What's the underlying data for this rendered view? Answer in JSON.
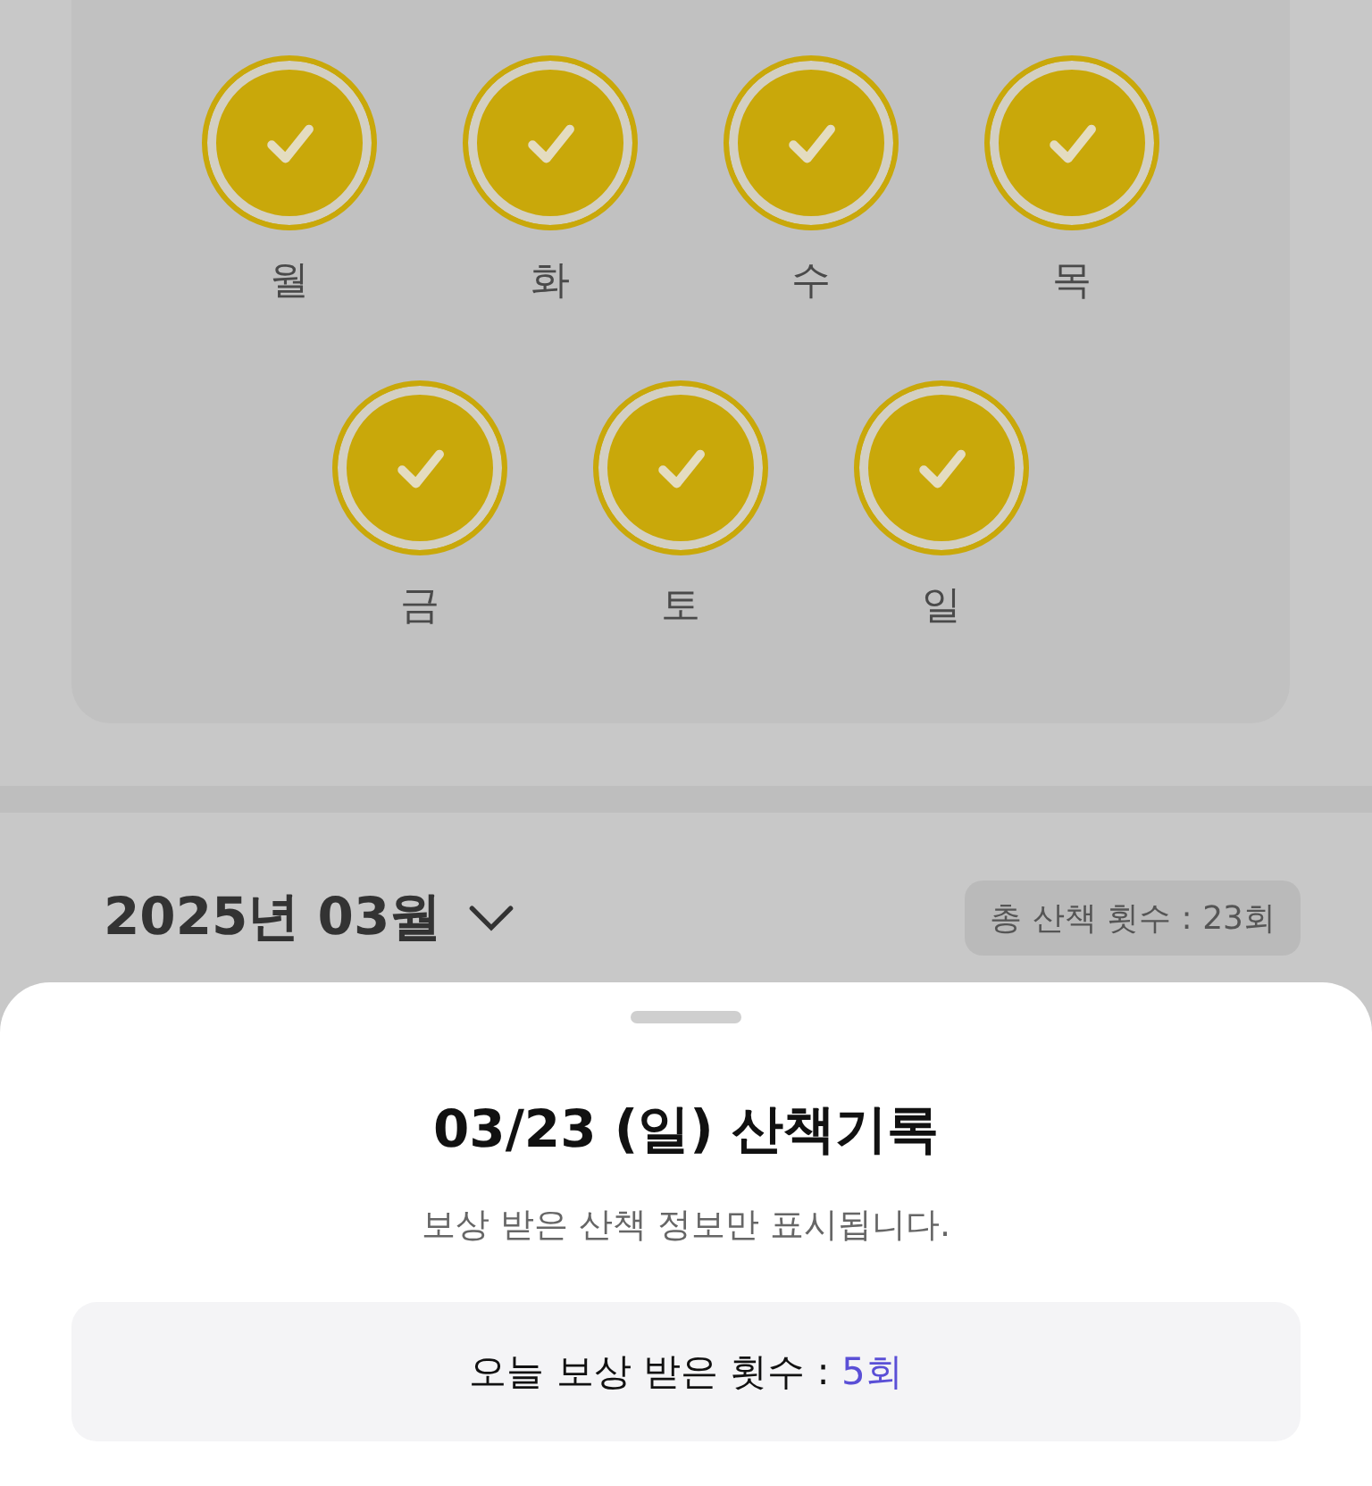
{
  "week_stamps": [
    {
      "label": "월",
      "checked": true
    },
    {
      "label": "화",
      "checked": true
    },
    {
      "label": "수",
      "checked": true
    },
    {
      "label": "목",
      "checked": true
    },
    {
      "label": "금",
      "checked": true
    },
    {
      "label": "토",
      "checked": true
    },
    {
      "label": "일",
      "checked": true
    }
  ],
  "month_selector": {
    "label": "2025년 03월"
  },
  "total_walks": "총 산책 횟수 : 23회",
  "bottom_sheet": {
    "title": "03/23 (일) 산책기록",
    "subtitle": "보상 받은 산책 정보만 표시됩니다.",
    "reward_label": "오늘 보상 받은 횟수 : ",
    "reward_value": "5회"
  }
}
